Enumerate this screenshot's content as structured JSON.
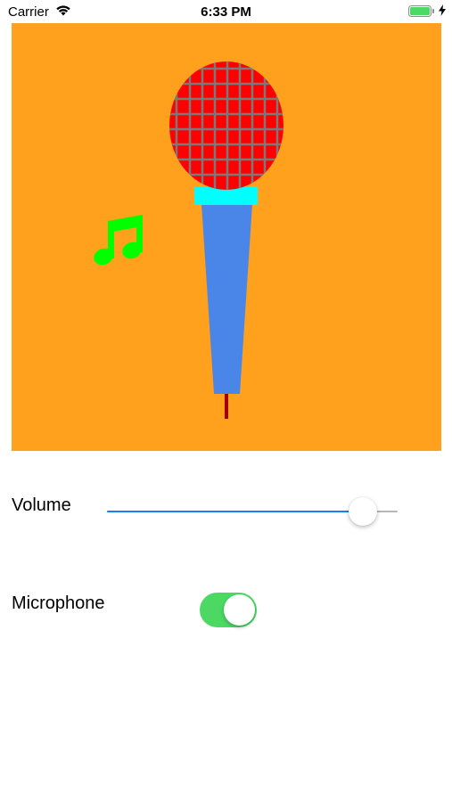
{
  "status_bar": {
    "carrier": "Carrier",
    "time": "6:33 PM",
    "wifi_icon": "wifi-icon",
    "battery_icon": "battery-icon",
    "charging_icon": "charging-bolt-icon"
  },
  "canvas": {
    "background_color": "#ffa11c",
    "microphone_head_color": "#ff0000",
    "grille_color": "#7a7a7a",
    "collar_color": "#00ffff",
    "handle_color": "#4a86e8",
    "cable_color": "#a30000",
    "music_note_color": "#00ff00",
    "icons": [
      "microphone-icon",
      "music-note-icon"
    ]
  },
  "controls": {
    "volume": {
      "label": "Volume",
      "value": 0.88,
      "track_color": "#b7b7b7",
      "fill_color": "#1c7ef6"
    },
    "microphone": {
      "label": "Microphone",
      "on": true,
      "on_color": "#4bd964"
    }
  }
}
